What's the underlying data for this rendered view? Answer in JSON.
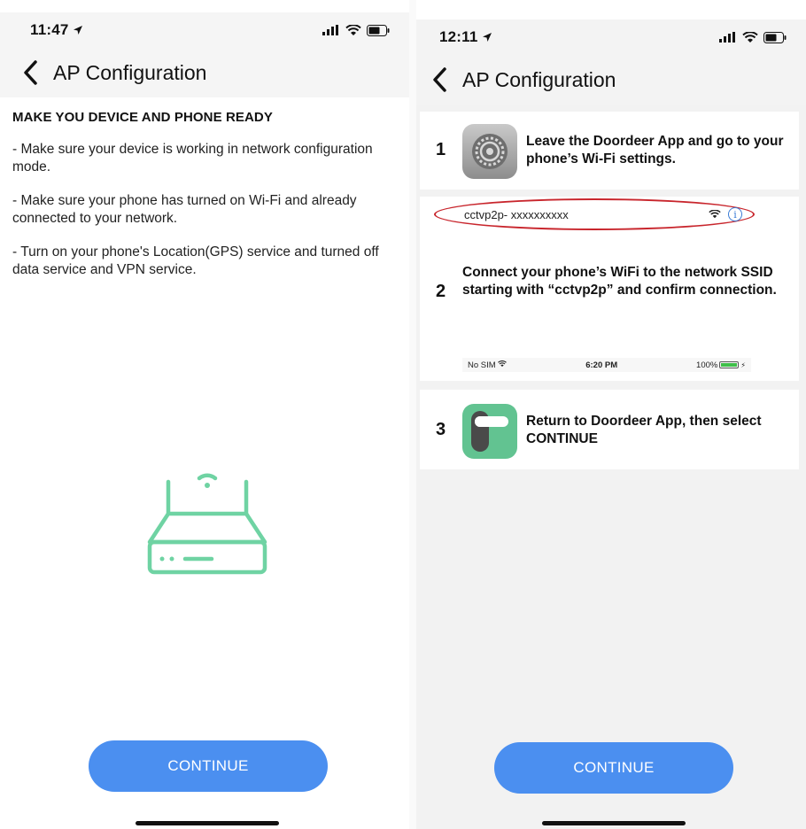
{
  "left_screen": {
    "status_time": "11:47",
    "nav_title": "AP Configuration",
    "heading": "MAKE YOU DEVICE AND PHONE READY",
    "instructions": [
      "- Make sure your device is working in network configuration mode.",
      " - Make sure your phone has turned on Wi-Fi and already connected to your network.",
      " - Turn on your phone's Location(GPS) service and turned off data service and VPN service."
    ],
    "illustration_icon": "router-wifi-icon",
    "continue_label": "CONTINUE"
  },
  "right_screen": {
    "status_time": "12:11",
    "nav_title": "AP Configuration",
    "steps": [
      {
        "number": "1",
        "text": "Leave the Doordeer App and go to your phone’s Wi-Fi settings.",
        "icon": "settings-gear-icon"
      },
      {
        "number": "2",
        "text": "Connect your phone’s WiFi to the network SSID starting with “cctvp2p” and confirm connection."
      },
      {
        "number": "3",
        "text": "Return to Doordeer App, then select CONTINUE",
        "icon": "door-handle-icon"
      }
    ],
    "wifi_example_ssid": "cctvp2p- xxxxxxxxxx",
    "info_glyph": "i",
    "mini_status": {
      "carrier": "No SIM",
      "time": "6:20 PM",
      "battery": "100%"
    },
    "continue_label": "CONTINUE"
  },
  "colors": {
    "accent_button": "#4b8ff0",
    "router_green": "#6fd3a3",
    "annotation_red": "#c8252c",
    "lock_icon_green": "#62c391"
  }
}
